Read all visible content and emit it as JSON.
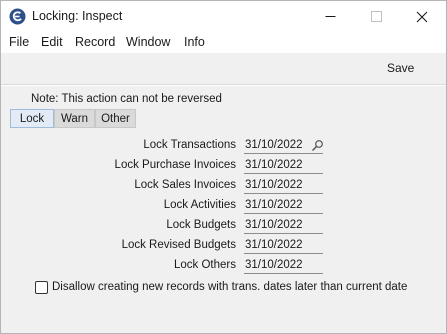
{
  "window": {
    "title": "Locking: Inspect"
  },
  "menu": {
    "items": [
      "File",
      "Edit",
      "Record",
      "Window",
      "Info"
    ]
  },
  "toolbar": {
    "save_label": "Save"
  },
  "note": "Note: This action can not be reversed",
  "tabs": [
    {
      "label": "Lock",
      "active": true
    },
    {
      "label": "Warn",
      "active": false
    },
    {
      "label": "Other",
      "active": false
    }
  ],
  "fields": [
    {
      "label": "Lock Transactions",
      "value": "31/10/2022"
    },
    {
      "label": "Lock Purchase Invoices",
      "value": "31/10/2022"
    },
    {
      "label": "Lock Sales Invoices",
      "value": "31/10/2022"
    },
    {
      "label": "Lock Activities",
      "value": "31/10/2022"
    },
    {
      "label": "Lock Budgets",
      "value": "31/10/2022"
    },
    {
      "label": "Lock Revised Budgets",
      "value": "31/10/2022"
    },
    {
      "label": "Lock Others",
      "value": "31/10/2022"
    }
  ],
  "checkbox": {
    "label": "Disallow creating new records with trans. dates later than current date",
    "checked": false
  },
  "icons": {
    "app": "app-logo-icon",
    "minimize": "minimize-icon",
    "maximize": "maximize-icon",
    "close": "close-icon",
    "paste": "magnifier-icon"
  },
  "colors": {
    "toolbar_bg": "#f0f0f0",
    "active_tab_bg": "#e3ecf6",
    "inactive_tab_bg": "#dadada"
  }
}
